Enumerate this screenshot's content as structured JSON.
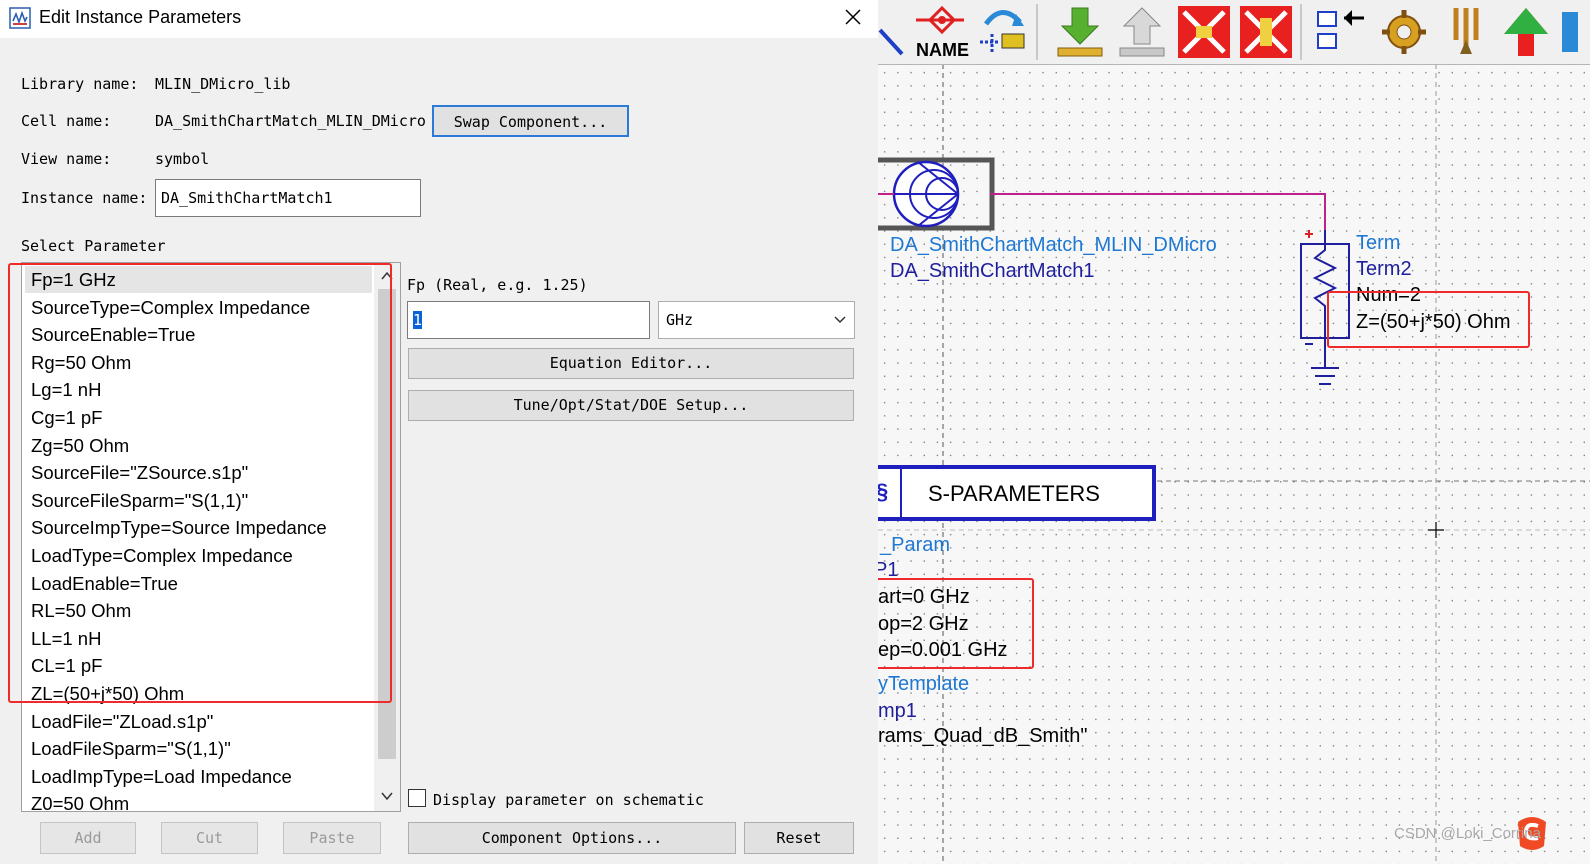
{
  "dialog": {
    "title": "Edit Instance Parameters",
    "library_label": "Library name:",
    "library_value": "MLIN_DMicro_lib",
    "cell_label": "Cell name:",
    "cell_value": "DA_SmithChartMatch_MLIN_DMicro",
    "swap_button": "Swap Component...",
    "view_label": "View name:",
    "view_value": "symbol",
    "instance_label": "Instance name:",
    "instance_value": "DA_SmithChartMatch1",
    "select_param_label": "Select Parameter",
    "parameters": [
      "Fp=1 GHz",
      "SourceType=Complex Impedance",
      "SourceEnable=True",
      "Rg=50 Ohm",
      "Lg=1 nH",
      "Cg=1 pF",
      "Zg=50 Ohm",
      "SourceFile=\"ZSource.s1p\"",
      "SourceFileSparm=\"S(1,1)\"",
      "SourceImpType=Source Impedance",
      "LoadType=Complex Impedance",
      "LoadEnable=True",
      "RL=50 Ohm",
      "LL=1 nH",
      "CL=1 pF",
      "ZL=(50+j*50) Ohm",
      "LoadFile=\"ZLoad.s1p\"",
      "LoadFileSparm=\"S(1,1)\"",
      "LoadImpType=Load Impedance",
      "Z0=50 Ohm"
    ],
    "param_desc": "Fp (Real, e.g. 1.25)",
    "param_value": "1",
    "unit_value": "GHz",
    "equation_editor": "Equation Editor...",
    "tune_setup": "Tune/Opt/Stat/DOE Setup...",
    "display_checkbox": "Display parameter on schematic",
    "add_button": "Add",
    "cut_button": "Cut",
    "paste_button": "Paste",
    "component_options": "Component Options...",
    "reset_button": "Reset"
  },
  "schematic": {
    "toolbar_name_label": "NAME",
    "cell_name": "DA_SmithChartMatch_MLIN_DMicro",
    "instance_name": "DA_SmithChartMatch1",
    "term_type": "Term",
    "term_name": "Term2",
    "term_num": "Num=2",
    "term_z": "Z=(50+j*50) Ohm",
    "sparam_title": "S-PARAMETERS",
    "sp_type": "_Param",
    "sp_name": "P1",
    "sp_start": "art=0 GHz",
    "sp_stop": "op=2 GHz",
    "sp_step": "ep=0.001 GHz",
    "tmpl_type": "yTemplate",
    "tmpl_name": "mp1",
    "tmpl_value": "rams_Quad_dB_Smith\"",
    "watermark": "CSDN @Loki_Corrina"
  },
  "colors": {
    "highlight_red": "#ef2a2a",
    "schematic_blue": "#1e78d2",
    "symbol_navy": "#1f1f9e",
    "wire_magenta": "#c0208a"
  }
}
